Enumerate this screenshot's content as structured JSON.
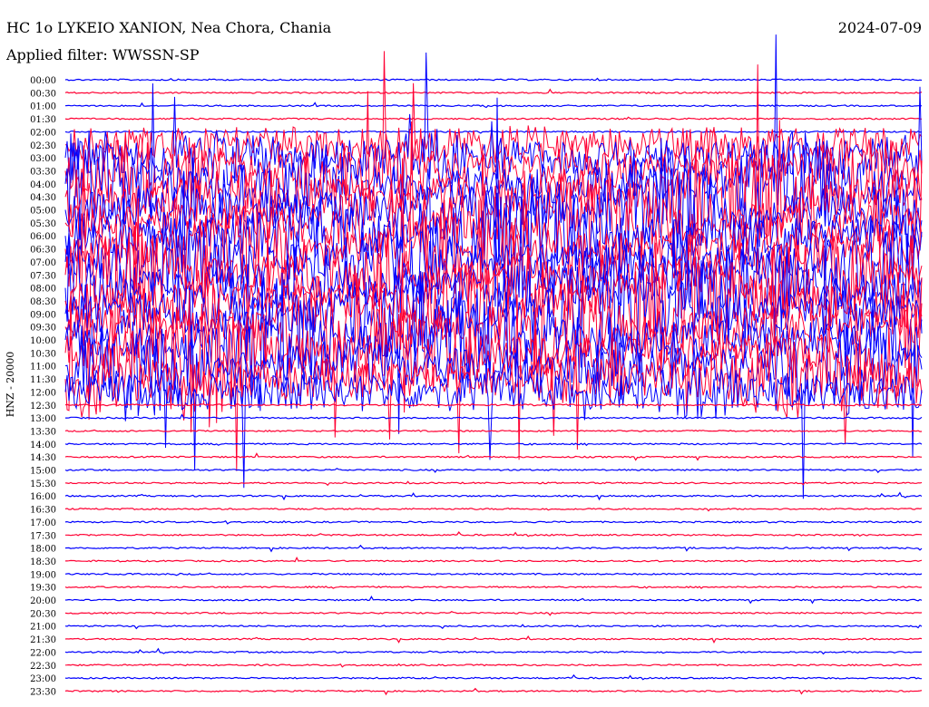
{
  "header": {
    "station": "HC 1o LYKEIO XANION, Nea Chora, Chania",
    "filter": "Applied filter: WWSSN-SP",
    "date": "2024-07-09"
  },
  "chart_data": {
    "type": "line",
    "title": "HC 1o LYKEIO XANION, Nea Chora, Chania",
    "subtitle": "Applied filter: WWSSN-SP",
    "date": "2024-07-09",
    "ylabel": "HNZ - 20000",
    "xlabel": "",
    "grid": false,
    "legend": "none",
    "row_labels": [
      "00:00",
      "00:30",
      "01:00",
      "01:30",
      "02:00",
      "02:30",
      "03:00",
      "03:30",
      "04:00",
      "04:30",
      "05:00",
      "05:30",
      "06:00",
      "06:30",
      "07:00",
      "07:30",
      "08:00",
      "08:30",
      "09:00",
      "09:30",
      "10:00",
      "10:30",
      "11:00",
      "11:30",
      "12:00",
      "12:30",
      "13:00",
      "13:30",
      "14:00",
      "14:30",
      "15:00",
      "15:30",
      "16:00",
      "16:30",
      "17:00",
      "17:30",
      "18:00",
      "18:30",
      "19:00",
      "19:30",
      "20:00",
      "20:30",
      "21:00",
      "21:30",
      "22:00",
      "22:30",
      "23:00",
      "23:30"
    ],
    "series_colors": [
      "#0000ff",
      "#ff0033"
    ],
    "activity_level": [
      0.02,
      0.03,
      0.02,
      0.03,
      0.02,
      0.18,
      0.45,
      0.62,
      0.72,
      0.85,
      0.82,
      0.8,
      0.85,
      0.78,
      0.7,
      0.72,
      0.75,
      0.9,
      0.95,
      0.92,
      0.88,
      0.9,
      0.7,
      0.6,
      0.35,
      0.08,
      0.04,
      0.04,
      0.03,
      0.02,
      0.02,
      0.02,
      0.02,
      0.02,
      0.02,
      0.03,
      0.03,
      0.03,
      0.02,
      0.02,
      0.02,
      0.02,
      0.02,
      0.02,
      0.02,
      0.02,
      0.02,
      0.02
    ]
  }
}
